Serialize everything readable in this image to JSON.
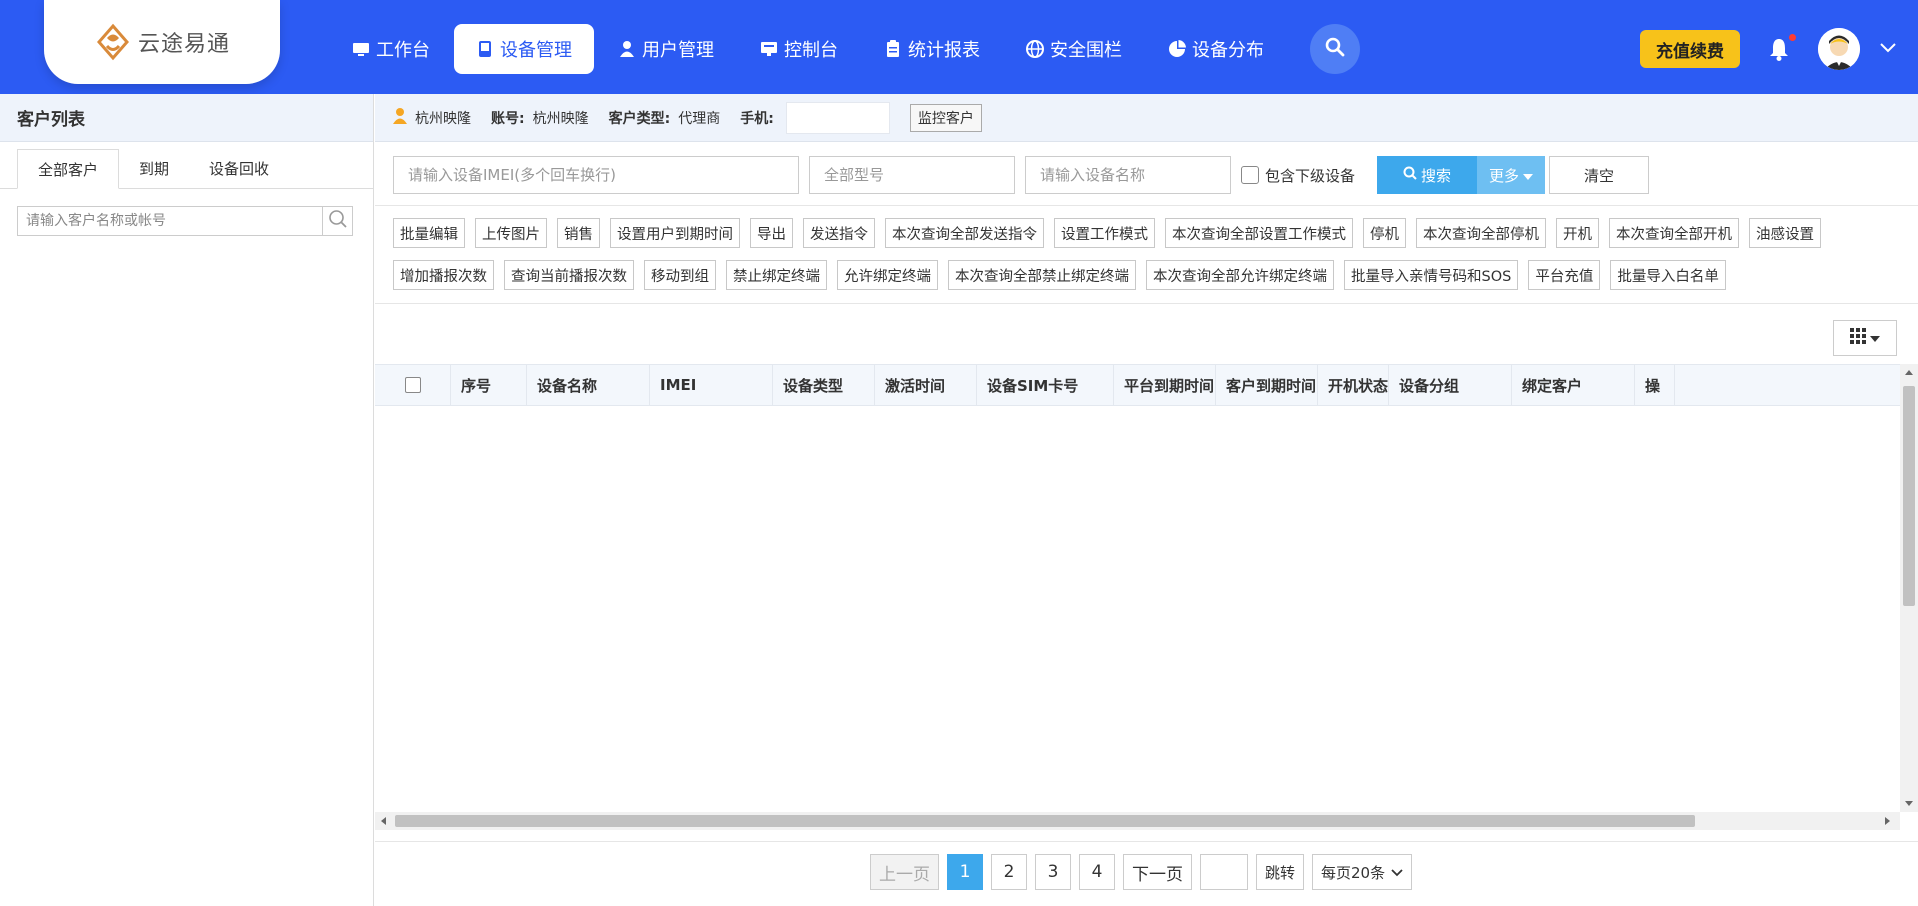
{
  "logo": {
    "text": "云途易通"
  },
  "nav": [
    {
      "label": "工作台",
      "icon": "monitor-icon",
      "active": false
    },
    {
      "label": "设备管理",
      "icon": "device-icon",
      "active": true
    },
    {
      "label": "用户管理",
      "icon": "user-icon",
      "active": false
    },
    {
      "label": "控制台",
      "icon": "console-icon",
      "active": false
    },
    {
      "label": "统计报表",
      "icon": "report-icon",
      "active": false
    },
    {
      "label": "安全围栏",
      "icon": "globe-icon",
      "active": false
    },
    {
      "label": "设备分布",
      "icon": "pie-icon",
      "active": false
    }
  ],
  "header": {
    "recharge_label": "充值续费"
  },
  "colors": {
    "brand": "#2c5bf3",
    "accent": "#3da8ec",
    "recharge": "#f7c21a"
  },
  "left": {
    "title": "客户列表",
    "tabs": [
      "全部客户",
      "到期",
      "设备回收"
    ],
    "search_placeholder": "请输入客户名称或帐号"
  },
  "info": {
    "customer_name": "杭州映隆",
    "account_label": "账号:",
    "account_value": "杭州映隆",
    "type_label": "客户类型:",
    "type_value": "代理商",
    "phone_label": "手机:",
    "monitor_label": "监控客户"
  },
  "filters": {
    "imei_placeholder": "请输入设备IMEI(多个回车换行)",
    "model_placeholder": "全部型号",
    "name_placeholder": "请输入设备名称",
    "include_sub_label": "包含下级设备",
    "search_label": "搜索",
    "more_label": "更多",
    "clear_label": "清空"
  },
  "actions": [
    "批量编辑",
    "上传图片",
    "销售",
    "设置用户到期时间",
    "导出",
    "发送指令",
    "本次查询全部发送指令",
    "设置工作模式",
    "本次查询全部设置工作模式",
    "停机",
    "本次查询全部停机",
    "开机",
    "本次查询全部开机",
    "油感设置",
    "增加播报次数",
    "查询当前播报次数",
    "移动到组",
    "禁止绑定终端",
    "允许绑定终端",
    "本次查询全部禁止绑定终端",
    "本次查询全部允许绑定终端",
    "批量导入亲情号码和SOS",
    "平台充值",
    "批量导入白名单"
  ],
  "table": {
    "columns": [
      "序号",
      "设备名称",
      "IMEI",
      "设备类型",
      "激活时间",
      "设备SIM卡号",
      "平台到期时间",
      "客户到期时间",
      "开机状态",
      "设备分组",
      "绑定客户",
      "操"
    ]
  },
  "pager": {
    "prev": "上一页",
    "pages": [
      "1",
      "2",
      "3",
      "4"
    ],
    "current": "1",
    "next": "下一页",
    "jump": "跳转",
    "page_size": "每页20条"
  }
}
